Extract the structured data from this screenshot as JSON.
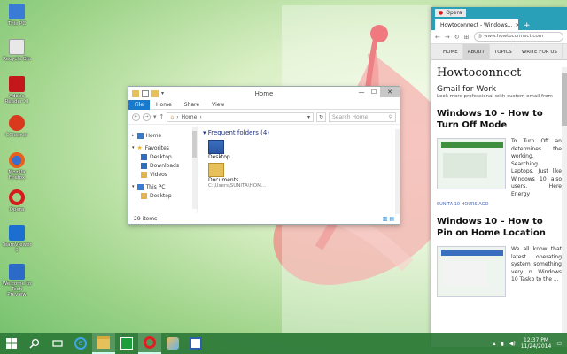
{
  "desktop": {
    "icons": [
      {
        "label": "This PC",
        "color": "#3a7bd5"
      },
      {
        "label": "Recycle Bin",
        "color": "#e8e8e8"
      },
      {
        "label": "Adobe Reader XI",
        "color": "#c4171c"
      },
      {
        "label": "CCleaner",
        "color": "#d93a1e"
      },
      {
        "label": "Mozilla Firefox",
        "color": "#e8611a"
      },
      {
        "label": "Opera",
        "color": "#d41d1d"
      },
      {
        "label": "TeamViewer 9",
        "color": "#1a6fd0"
      },
      {
        "label": "Welcome to Tech Preview",
        "color": "#2b6bc7"
      }
    ]
  },
  "explorer": {
    "title": "Home",
    "ribbon_tabs": [
      "File",
      "Home",
      "Share",
      "View"
    ],
    "address": "Home",
    "search_placeholder": "Search Home",
    "nav_items": [
      {
        "label": "Home",
        "color": "#3a78c9"
      },
      {
        "label": "Favorites",
        "color": "#f3b51b"
      },
      {
        "label": "Desktop",
        "color": "#2f6fc0"
      },
      {
        "label": "Downloads",
        "color": "#2f6fc0"
      },
      {
        "label": "Videos",
        "color": "#e0b44a"
      },
      {
        "label": "This PC",
        "color": "#3a7bd5"
      },
      {
        "label": "Desktop",
        "color": "#e0b44a"
      }
    ],
    "section_header": "Frequent folders (4)",
    "folders": [
      {
        "name": "Desktop",
        "sub": ""
      },
      {
        "name": "Documents",
        "sub": "C:\\Users\\SUNITA\\HOM..."
      }
    ],
    "status_items": "29 items"
  },
  "opera": {
    "menu_label": "Opera",
    "tab_title": "Howtoconnect - Windows...",
    "url": "www.howtoconnect.com",
    "site_nav": [
      "HOME",
      "ABOUT",
      "TOPICS",
      "WRITE FOR US"
    ],
    "logo": "Howtoconnect",
    "ad_title": "Gmail for Work",
    "ad_text": "Look more professional with custom email from",
    "article1": {
      "title": "Windows 10 – How to Turn Off Mode",
      "text": "To Turn Off an determines the working. Searching Laptops. Just like Windows 10 also users. Here Energy",
      "meta": "SUNITA  10 HOURS AGO"
    },
    "article2": {
      "title": "Windows 10 – How to Pin on Home Location",
      "text": "We all know that latest operating system something very n Windows 10 Taskb to the ..."
    },
    "clock": {
      "time": "12:37 PM",
      "date": "11/24/2014"
    }
  }
}
